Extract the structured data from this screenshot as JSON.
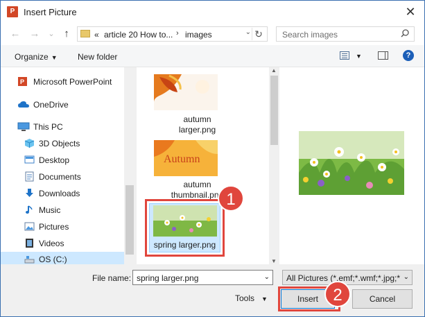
{
  "window": {
    "title": "Insert Picture",
    "app_icon": "P",
    "close": "✕"
  },
  "nav": {
    "back": "←",
    "forward": "→",
    "recent": "⌄",
    "up": "↑",
    "address": {
      "prefix": "«",
      "part1": "article 20 How to...",
      "sep": "›",
      "part2": "images",
      "refresh": "↻"
    },
    "search_placeholder": "Search images"
  },
  "toolbar": {
    "organize": "Organize",
    "new_folder": "New folder",
    "help": "?"
  },
  "sidebar": {
    "items": [
      {
        "label": "Microsoft PowerPoint",
        "icon": "powerpoint-icon"
      },
      {
        "label": "OneDrive",
        "icon": "cloud-icon"
      },
      {
        "label": "This PC",
        "icon": "computer-icon"
      },
      {
        "label": "3D Objects",
        "icon": "cube-icon"
      },
      {
        "label": "Desktop",
        "icon": "desktop-icon"
      },
      {
        "label": "Documents",
        "icon": "document-icon"
      },
      {
        "label": "Downloads",
        "icon": "download-icon"
      },
      {
        "label": "Music",
        "icon": "music-icon"
      },
      {
        "label": "Pictures",
        "icon": "pictures-icon"
      },
      {
        "label": "Videos",
        "icon": "video-icon"
      },
      {
        "label": "OS (C:)",
        "icon": "drive-icon"
      }
    ]
  },
  "files": [
    {
      "name_line1": "autumn",
      "name_line2": "larger.png"
    },
    {
      "name_line1": "autumn",
      "name_line2": "thumbnail.png",
      "thumb_text": "Autumn"
    },
    {
      "name_line1": "spring larger.png",
      "selected": true
    }
  ],
  "bottom": {
    "file_name_label": "File name:",
    "file_name_value": "spring larger.png",
    "filter_value": "All Pictures (*.emf;*.wmf;*.jpg;*",
    "tools": "Tools",
    "insert": "Insert",
    "cancel": "Cancel"
  },
  "annotations": {
    "step1": "1",
    "step2": "2",
    "color": "#e0463d"
  }
}
